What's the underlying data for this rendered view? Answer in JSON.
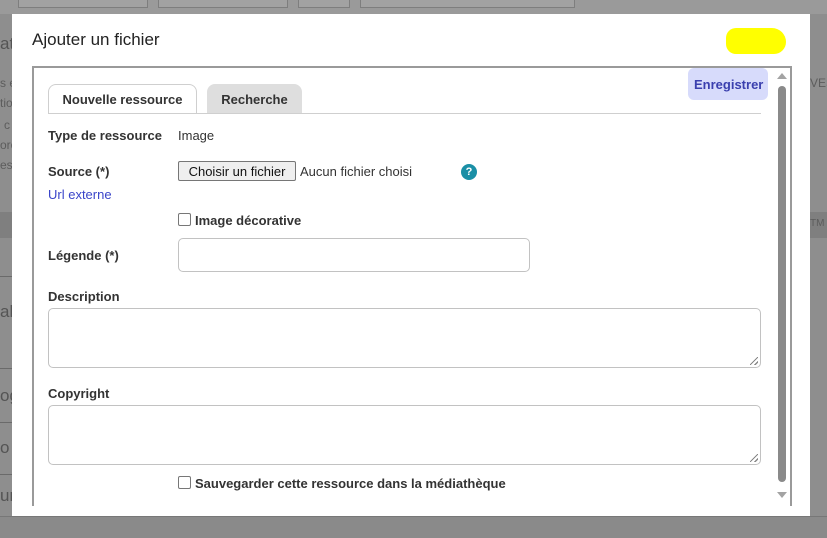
{
  "modal": {
    "title": "Ajouter un fichier",
    "save_label": "Enregistrer"
  },
  "tabs": [
    {
      "label": "Nouvelle ressource",
      "active": true
    },
    {
      "label": "Recherche",
      "active": false
    }
  ],
  "form": {
    "type_label": "Type de ressource",
    "type_value": "Image",
    "source_label": "Source (*)",
    "file_button_label": "Choisir un fichier",
    "no_file_text": "Aucun fichier choisi",
    "help_icon_glyph": "?",
    "url_externe_label": "Url externe",
    "decorative_label": "Image décorative",
    "legende_label": "Légende (*)",
    "legende_value": "",
    "description_label": "Description",
    "description_value": "",
    "copyright_label": "Copyright",
    "copyright_value": "",
    "save_library_label": "Sauvegarder cette ressource dans la médiathèque"
  },
  "background": {
    "fragments": [
      "at",
      "s e",
      "tio",
      "c",
      "oro",
      "es",
      "al",
      "og",
      "o",
      "un",
      "VES",
      "TM"
    ]
  },
  "colors": {
    "accent": "#3a3fae",
    "save_bg": "#d7dbfb",
    "link": "#3a45c9",
    "help_icon": "#1a8fa6",
    "highlight": "#ffff00"
  }
}
